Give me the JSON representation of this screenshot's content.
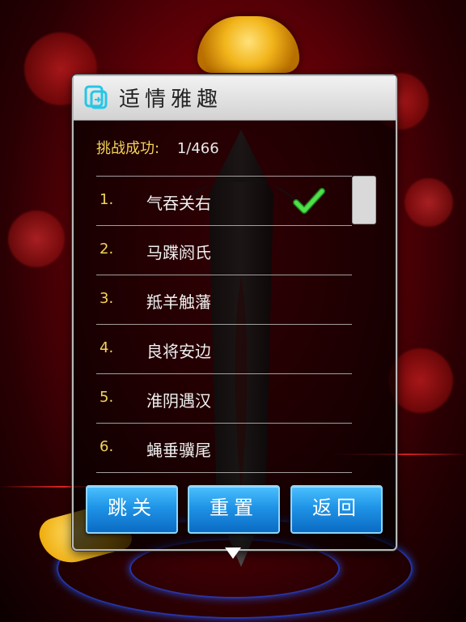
{
  "dialog": {
    "title": "适情雅趣",
    "stats": {
      "label": "挑战成功:",
      "value": "1/466"
    },
    "levels": [
      {
        "index": "1.",
        "name": "气吞关右",
        "completed": true
      },
      {
        "index": "2.",
        "name": "马蹀阏氏",
        "completed": false
      },
      {
        "index": "3.",
        "name": "羝羊触藩",
        "completed": false
      },
      {
        "index": "4.",
        "name": "良将安边",
        "completed": false
      },
      {
        "index": "5.",
        "name": "淮阴遇汉",
        "completed": false
      },
      {
        "index": "6.",
        "name": "蝇垂骥尾",
        "completed": false
      }
    ],
    "buttons": {
      "skip": "跳关",
      "reset": "重置",
      "back": "返回"
    }
  },
  "icons": {
    "title": "dialog-logo-icon",
    "completed": "checkmark-icon",
    "down": "triangle-down-icon"
  },
  "colors": {
    "accent_yellow": "#f5d25a",
    "button_blue": "#1f94e6",
    "check_green": "#2fbe2a"
  }
}
